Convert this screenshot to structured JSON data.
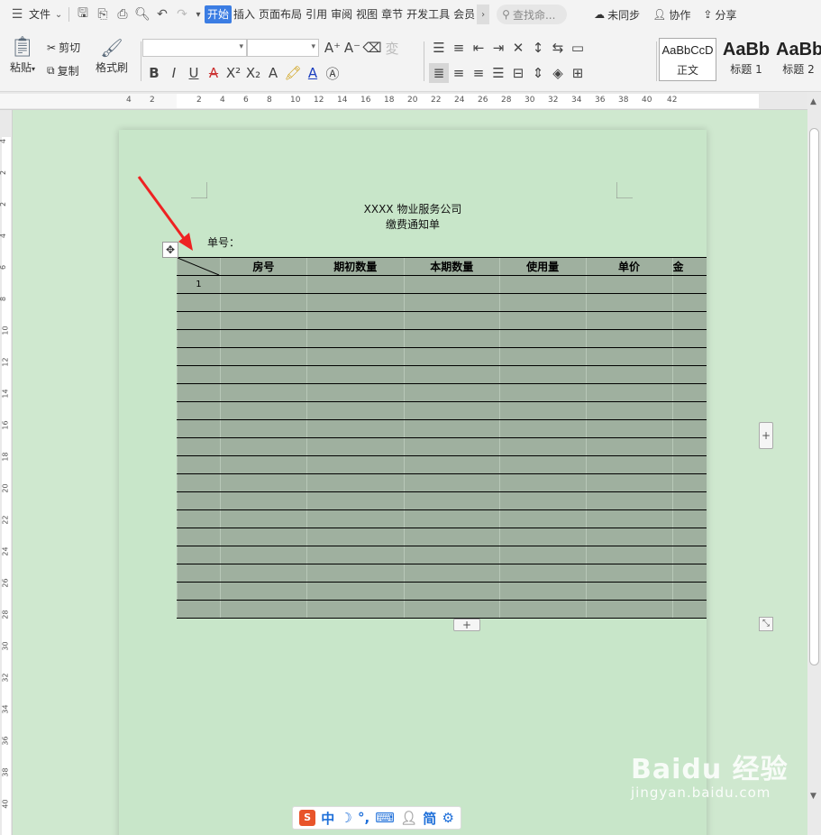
{
  "menubar": {
    "file_label": "文件",
    "tabs": [
      "开始",
      "插入",
      "页面布局",
      "引用",
      "审阅",
      "视图",
      "章节",
      "开发工具",
      "会员"
    ],
    "search_placeholder": "查找命...",
    "unsynced": "未同步",
    "collab": "协作",
    "share": "分享"
  },
  "ribbon": {
    "paste": "粘贴",
    "cut": "剪切",
    "copy": "复制",
    "format_painter": "格式刷",
    "style_preview_1": "AaBbCcD",
    "style_preview_2": "AaBb",
    "style_preview_3": "AaBb",
    "style_normal": "正文",
    "style_h1": "标题 1",
    "style_h2": "标题 2"
  },
  "ruler": {
    "ticks": [
      "4",
      "2",
      "2",
      "4",
      "6",
      "8",
      "10",
      "12",
      "14",
      "16",
      "18",
      "20",
      "22",
      "24",
      "26",
      "28",
      "30",
      "32",
      "34",
      "36",
      "38",
      "40",
      "42"
    ]
  },
  "document": {
    "company": "XXXX 物业服务公司",
    "title": "缴费通知单",
    "order_label": "单号：",
    "columns": [
      "",
      "房号",
      "期初数量",
      "本期数量",
      "使用量",
      "单价",
      "金"
    ],
    "first_row_number": "1",
    "rows_count": 19
  },
  "ime": {
    "lang": "中",
    "simplified": "简"
  },
  "watermark": {
    "brand": "Baidu 经验",
    "url": "jingyan.baidu.com"
  }
}
